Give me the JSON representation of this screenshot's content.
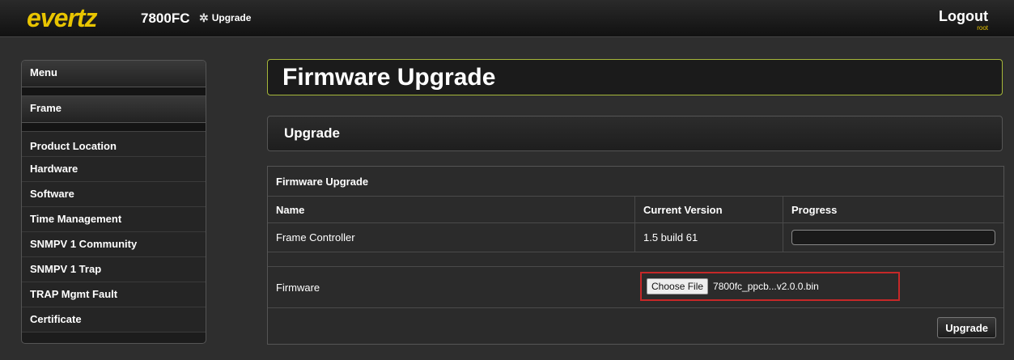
{
  "header": {
    "logo": "evertz",
    "model": "7800FC",
    "upgrade_link": "Upgrade",
    "logout": "Logout",
    "user": "root"
  },
  "sidebar": {
    "menu": "Menu",
    "frame": "Frame",
    "items": [
      {
        "label": "Product Location"
      },
      {
        "label": "Hardware"
      },
      {
        "label": "Software"
      },
      {
        "label": "Time Management"
      },
      {
        "label": "SNMPV 1 Community"
      },
      {
        "label": "SNMPV 1 Trap"
      },
      {
        "label": "TRAP Mgmt Fault"
      },
      {
        "label": "Certificate"
      }
    ]
  },
  "main": {
    "title": "Firmware Upgrade",
    "section": "Upgrade",
    "table": {
      "caption": "Firmware Upgrade",
      "headers": {
        "name": "Name",
        "current_version": "Current Version",
        "progress": "Progress"
      },
      "row": {
        "name": "Frame Controller",
        "current_version": "1.5 build 61",
        "progress": 0
      },
      "firmware_label": "Firmware",
      "choose_file": "Choose File",
      "file_name": "7800fc_ppcb...v2.0.0.bin",
      "upgrade_button": "Upgrade"
    }
  },
  "colors": {
    "accent": "#e8c400",
    "highlight": "#c62828",
    "title_border": "#a6b73a"
  }
}
